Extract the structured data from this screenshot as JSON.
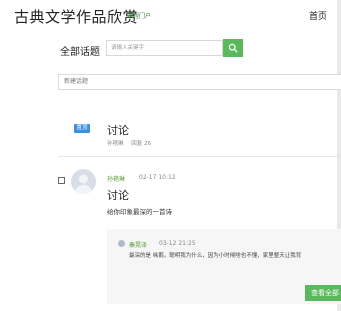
{
  "header": {
    "site_title": "古典文学作品欣赏",
    "site_subtitle": "课程门户",
    "nav_home": "首页"
  },
  "search": {
    "label": "全部话题",
    "placeholder": "请输入关键字",
    "button_icon": "search-icon"
  },
  "new_topic": {
    "label": "新建话题"
  },
  "pinned_topic": {
    "badge": "置顶",
    "title": "讨论",
    "author": "孙艳琳",
    "reply_count": "回复 26"
  },
  "post": {
    "author": "孙艳琳",
    "date": "02-17 10:12",
    "title": "讨论",
    "body": "给你印象最深的一首诗"
  },
  "reply": {
    "author": "秦晃泽",
    "date": "03-12 21:25",
    "text": "最深的是 咏鹅，聪明我为什么，因为小时候啥也不懂，家里整天让我背"
  },
  "actions": {
    "view_all": "查看全部"
  },
  "colors": {
    "accent_green": "#5cb85c",
    "badge_blue": "#3d8fe0",
    "author_green": "#5a9d35"
  }
}
